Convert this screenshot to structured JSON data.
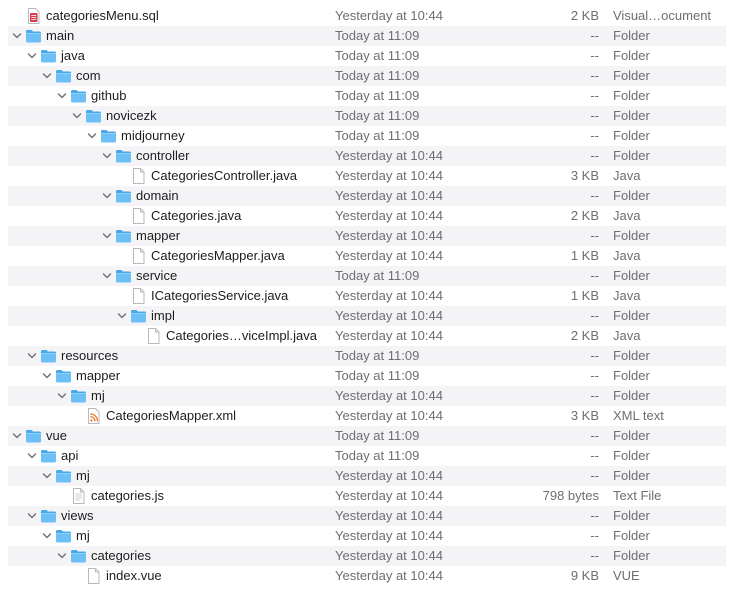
{
  "rows": [
    {
      "name": "categoriesMenu.sql",
      "date": "Yesterday at 10:44",
      "size": "2 KB",
      "kind": "Visual…ocument",
      "icon": "sql-file-icon",
      "depth": 0,
      "expanded": null
    },
    {
      "name": "main",
      "date": "Today at 11:09",
      "size": "--",
      "kind": "Folder",
      "icon": "folder-icon",
      "depth": 0,
      "expanded": true
    },
    {
      "name": "java",
      "date": "Today at 11:09",
      "size": "--",
      "kind": "Folder",
      "icon": "folder-icon",
      "depth": 1,
      "expanded": true
    },
    {
      "name": "com",
      "date": "Today at 11:09",
      "size": "--",
      "kind": "Folder",
      "icon": "folder-icon",
      "depth": 2,
      "expanded": true
    },
    {
      "name": "github",
      "date": "Today at 11:09",
      "size": "--",
      "kind": "Folder",
      "icon": "folder-icon",
      "depth": 3,
      "expanded": true
    },
    {
      "name": "novicezk",
      "date": "Today at 11:09",
      "size": "--",
      "kind": "Folder",
      "icon": "folder-icon",
      "depth": 4,
      "expanded": true
    },
    {
      "name": "midjourney",
      "date": "Today at 11:09",
      "size": "--",
      "kind": "Folder",
      "icon": "folder-icon",
      "depth": 5,
      "expanded": true
    },
    {
      "name": "controller",
      "date": "Yesterday at 10:44",
      "size": "--",
      "kind": "Folder",
      "icon": "folder-icon",
      "depth": 6,
      "expanded": true
    },
    {
      "name": "CategoriesController.java",
      "date": "Yesterday at 10:44",
      "size": "3 KB",
      "kind": "Java",
      "icon": "document-icon",
      "depth": 7,
      "expanded": null
    },
    {
      "name": "domain",
      "date": "Yesterday at 10:44",
      "size": "--",
      "kind": "Folder",
      "icon": "folder-icon",
      "depth": 6,
      "expanded": true
    },
    {
      "name": "Categories.java",
      "date": "Yesterday at 10:44",
      "size": "2 KB",
      "kind": "Java",
      "icon": "document-icon",
      "depth": 7,
      "expanded": null
    },
    {
      "name": "mapper",
      "date": "Yesterday at 10:44",
      "size": "--",
      "kind": "Folder",
      "icon": "folder-icon",
      "depth": 6,
      "expanded": true
    },
    {
      "name": "CategoriesMapper.java",
      "date": "Yesterday at 10:44",
      "size": "1 KB",
      "kind": "Java",
      "icon": "document-icon",
      "depth": 7,
      "expanded": null
    },
    {
      "name": "service",
      "date": "Today at 11:09",
      "size": "--",
      "kind": "Folder",
      "icon": "folder-icon",
      "depth": 6,
      "expanded": true
    },
    {
      "name": "ICategoriesService.java",
      "date": "Yesterday at 10:44",
      "size": "1 KB",
      "kind": "Java",
      "icon": "document-icon",
      "depth": 7,
      "expanded": null
    },
    {
      "name": "impl",
      "date": "Yesterday at 10:44",
      "size": "--",
      "kind": "Folder",
      "icon": "folder-icon",
      "depth": 7,
      "expanded": true
    },
    {
      "name": "Categories…viceImpl.java",
      "date": "Yesterday at 10:44",
      "size": "2 KB",
      "kind": "Java",
      "icon": "document-icon",
      "depth": 8,
      "expanded": null
    },
    {
      "name": "resources",
      "date": "Today at 11:09",
      "size": "--",
      "kind": "Folder",
      "icon": "folder-icon",
      "depth": 1,
      "expanded": true
    },
    {
      "name": "mapper",
      "date": "Today at 11:09",
      "size": "--",
      "kind": "Folder",
      "icon": "folder-icon",
      "depth": 2,
      "expanded": true
    },
    {
      "name": "mj",
      "date": "Yesterday at 10:44",
      "size": "--",
      "kind": "Folder",
      "icon": "folder-icon",
      "depth": 3,
      "expanded": true
    },
    {
      "name": "CategoriesMapper.xml",
      "date": "Yesterday at 10:44",
      "size": "3 KB",
      "kind": "XML text",
      "icon": "xml-file-icon",
      "depth": 4,
      "expanded": null
    },
    {
      "name": "vue",
      "date": "Today at 11:09",
      "size": "--",
      "kind": "Folder",
      "icon": "folder-icon",
      "depth": 0,
      "expanded": true
    },
    {
      "name": "api",
      "date": "Today at 11:09",
      "size": "--",
      "kind": "Folder",
      "icon": "folder-icon",
      "depth": 1,
      "expanded": true
    },
    {
      "name": "mj",
      "date": "Yesterday at 10:44",
      "size": "--",
      "kind": "Folder",
      "icon": "folder-icon",
      "depth": 2,
      "expanded": true
    },
    {
      "name": "categories.js",
      "date": "Yesterday at 10:44",
      "size": "798 bytes",
      "kind": "Text File",
      "icon": "text-file-icon",
      "depth": 3,
      "expanded": null
    },
    {
      "name": "views",
      "date": "Yesterday at 10:44",
      "size": "--",
      "kind": "Folder",
      "icon": "folder-icon",
      "depth": 1,
      "expanded": true
    },
    {
      "name": "mj",
      "date": "Yesterday at 10:44",
      "size": "--",
      "kind": "Folder",
      "icon": "folder-icon",
      "depth": 2,
      "expanded": true
    },
    {
      "name": "categories",
      "date": "Yesterday at 10:44",
      "size": "--",
      "kind": "Folder",
      "icon": "folder-icon",
      "depth": 3,
      "expanded": true
    },
    {
      "name": "index.vue",
      "date": "Yesterday at 10:44",
      "size": "9 KB",
      "kind": "VUE",
      "icon": "document-icon",
      "depth": 4,
      "expanded": null
    }
  ],
  "colors": {
    "stripe": "#f4f4f6",
    "folder_front": "#6cc0f5",
    "folder_back": "#49a8e8",
    "secondary_text": "#6e6e73",
    "primary_text": "#1d1d1f"
  }
}
